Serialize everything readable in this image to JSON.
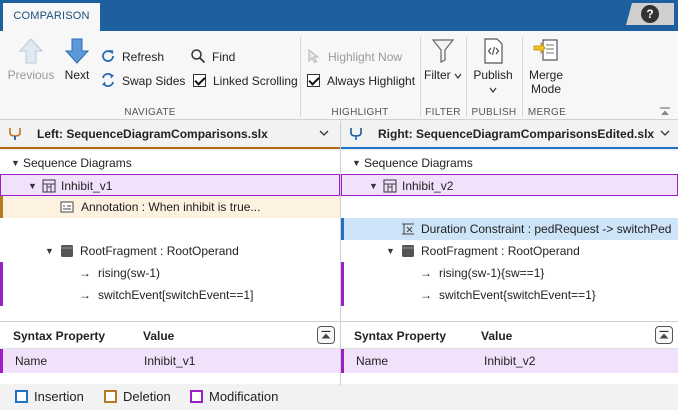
{
  "tab": {
    "label": "COMPARISON"
  },
  "help": {
    "label": "?"
  },
  "ribbon": {
    "navigate": {
      "label": "NAVIGATE",
      "previous": "Previous",
      "next": "Next",
      "refresh": "Refresh",
      "swap_sides": "Swap Sides",
      "find": "Find",
      "linked_scrolling": "Linked Scrolling",
      "linked_scrolling_checked": true
    },
    "highlight": {
      "label": "HIGHLIGHT",
      "highlight_now": "Highlight Now",
      "always_highlight": "Always Highlight",
      "always_highlight_checked": true
    },
    "filter": {
      "label": "FILTER",
      "button": "Filter"
    },
    "publish": {
      "label": "PUBLISH",
      "button": "Publish"
    },
    "merge": {
      "label": "MERGE",
      "button_line1": "Merge",
      "button_line2": "Mode"
    }
  },
  "left": {
    "prefix": "Left:",
    "file": "SequenceDiagramComparisons.slx",
    "tree": {
      "root": "Sequence Diagrams",
      "diagram": "Inhibit_v1",
      "annotation": "Annotation : When inhibit is true...",
      "fragment": "RootFragment : RootOperand",
      "msg1": "rising(sw-1)",
      "msg2": "switchEvent[switchEvent==1]"
    },
    "props": {
      "col_property": "Syntax Property",
      "col_value": "Value",
      "rows": [
        {
          "property": "Name",
          "value": "Inhibit_v1"
        }
      ]
    }
  },
  "right": {
    "prefix": "Right:",
    "file": "SequenceDiagramComparisonsEdited.slx",
    "tree": {
      "root": "Sequence Diagrams",
      "diagram": "Inhibit_v2",
      "constraint": "Duration Constraint : pedRequest -> switchPed",
      "fragment": "RootFragment : RootOperand",
      "msg1": "rising(sw-1){sw==1}",
      "msg2": "switchEvent{switchEvent==1}"
    },
    "props": {
      "col_property": "Syntax Property",
      "col_value": "Value",
      "rows": [
        {
          "property": "Name",
          "value": "Inhibit_v2"
        }
      ]
    }
  },
  "legend": {
    "insertion": "Insertion",
    "deletion": "Deletion",
    "modification": "Modification"
  },
  "colors": {
    "tab_bar": "#1d5f9f",
    "insertion": "#1e73c8",
    "deletion": "#b67a25",
    "modification": "#9b1ec9",
    "modification_fill": "#f1e1fb"
  }
}
